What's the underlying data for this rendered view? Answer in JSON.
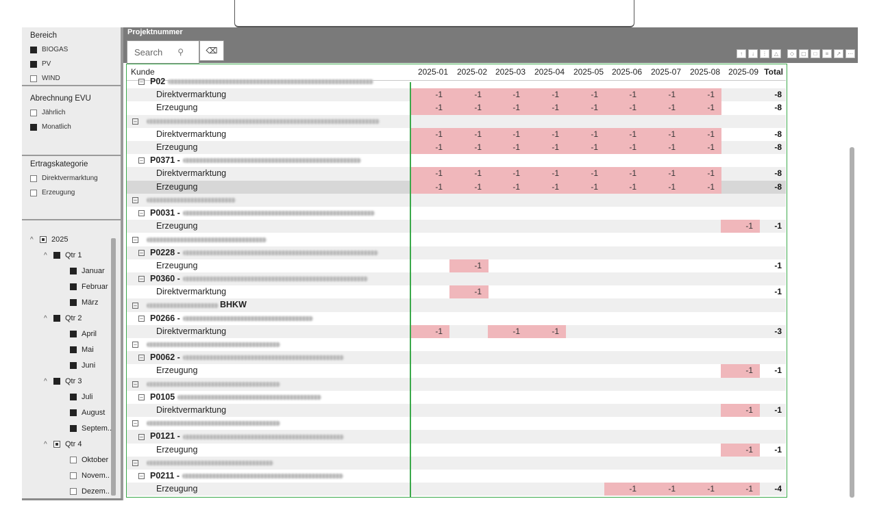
{
  "slicers": {
    "bereich": {
      "title": "Bereich",
      "options": [
        {
          "label": "BIOGAS",
          "checked": true
        },
        {
          "label": "PV",
          "checked": true
        },
        {
          "label": "WIND",
          "checked": false
        }
      ]
    },
    "abrechnung": {
      "title": "Abrechnung EVU",
      "options": [
        {
          "label": "Jährlich",
          "checked": false
        },
        {
          "label": "Monatlich",
          "checked": true
        }
      ]
    },
    "ertragskategorie": {
      "title": "Ertragskategorie",
      "options": [
        {
          "label": "Direktvermarktung",
          "checked": false
        },
        {
          "label": "Erzeugung",
          "checked": false
        }
      ]
    }
  },
  "date_tree": {
    "year": "2025",
    "quarters": [
      {
        "label": "Qtr 1",
        "state": "on",
        "months": [
          {
            "label": "Januar",
            "checked": true
          },
          {
            "label": "Februar",
            "checked": true
          },
          {
            "label": "März",
            "checked": true
          }
        ]
      },
      {
        "label": "Qtr 2",
        "state": "on",
        "months": [
          {
            "label": "April",
            "checked": true
          },
          {
            "label": "Mai",
            "checked": true
          },
          {
            "label": "Juni",
            "checked": true
          }
        ]
      },
      {
        "label": "Qtr 3",
        "state": "on",
        "months": [
          {
            "label": "Juli",
            "checked": true
          },
          {
            "label": "August",
            "checked": true
          },
          {
            "label": "Septem..",
            "checked": true
          }
        ]
      },
      {
        "label": "Qtr 4",
        "state": "partial",
        "months": [
          {
            "label": "Oktober",
            "checked": false
          },
          {
            "label": "Novem..",
            "checked": false
          },
          {
            "label": "Dezem..",
            "checked": false
          }
        ]
      }
    ]
  },
  "projekt": {
    "label": "Projektnummer",
    "search_placeholder": "Search",
    "search_icon": "search-icon",
    "eraser_icon": "eraser-icon"
  },
  "visual_icons": [
    "sort-asc-icon",
    "sort-desc-icon",
    "drill-icon",
    "expand-icon",
    "pin-icon",
    "copy-icon",
    "comment-icon",
    "filter-icon",
    "focus-icon",
    "more-icon"
  ],
  "matrix": {
    "header": {
      "kunde": "Kunde",
      "months": [
        "2025-01",
        "2025-02",
        "2025-03",
        "2025-04",
        "2025-05",
        "2025-06",
        "2025-07",
        "2025-08",
        "2025-09"
      ],
      "total": "Total"
    },
    "rows": [
      {
        "level": 1,
        "label": "P02",
        "blur": 300,
        "bold": true,
        "values": [],
        "total": ""
      },
      {
        "level": 2,
        "label": "Direktvermarktung",
        "values": [
          -1,
          -1,
          -1,
          -1,
          -1,
          -1,
          -1,
          -1,
          null
        ],
        "total": "-8"
      },
      {
        "level": 2,
        "label": "Erzeugung",
        "values": [
          -1,
          -1,
          -1,
          -1,
          -1,
          -1,
          -1,
          -1,
          null
        ],
        "total": "-8"
      },
      {
        "level": 0,
        "label": "",
        "blur": 340,
        "values": [],
        "total": ""
      },
      {
        "level": 2,
        "label": "Direktvermarktung",
        "values": [
          -1,
          -1,
          -1,
          -1,
          -1,
          -1,
          -1,
          -1,
          null
        ],
        "total": "-8"
      },
      {
        "level": 2,
        "label": "Erzeugung",
        "values": [
          -1,
          -1,
          -1,
          -1,
          -1,
          -1,
          -1,
          -1,
          null
        ],
        "total": "-8"
      },
      {
        "level": 1,
        "label": "P0371 -",
        "blur": 260,
        "bold": true,
        "values": [],
        "total": ""
      },
      {
        "level": 2,
        "label": "Direktvermarktung",
        "values": [
          -1,
          -1,
          -1,
          -1,
          -1,
          -1,
          -1,
          -1,
          null
        ],
        "total": "-8"
      },
      {
        "level": 2,
        "label": "Erzeugung",
        "values": [
          -1,
          -1,
          -1,
          -1,
          -1,
          -1,
          -1,
          -1,
          null
        ],
        "total": "-8",
        "selected": true
      },
      {
        "level": 0,
        "label": "",
        "blur": 130,
        "values": [],
        "total": ""
      },
      {
        "level": 1,
        "label": "P0031 -",
        "blur": 280,
        "bold": true,
        "values": [],
        "total": ""
      },
      {
        "level": 2,
        "label": "Erzeugung",
        "values": [
          null,
          null,
          null,
          null,
          null,
          null,
          null,
          null,
          -1
        ],
        "total": "-1"
      },
      {
        "level": 0,
        "label": "",
        "blur": 175,
        "values": [],
        "total": ""
      },
      {
        "level": 1,
        "label": "P0228 -",
        "blur": 285,
        "bold": true,
        "values": [],
        "total": ""
      },
      {
        "level": 2,
        "label": "Erzeugung",
        "values": [
          null,
          -1,
          null,
          null,
          null,
          null,
          null,
          null,
          null
        ],
        "total": "-1"
      },
      {
        "level": 1,
        "label": "P0360 -",
        "blur": 270,
        "bold": true,
        "values": [],
        "total": ""
      },
      {
        "level": 2,
        "label": "Direktvermarktung",
        "values": [
          null,
          -1,
          null,
          null,
          null,
          null,
          null,
          null,
          null
        ],
        "total": "-1"
      },
      {
        "level": 0,
        "label": "BHKW",
        "blur": 105,
        "bold": true,
        "values": [],
        "total": ""
      },
      {
        "level": 1,
        "label": "P0266 -",
        "blur": 190,
        "bold": true,
        "values": [],
        "total": ""
      },
      {
        "level": 2,
        "label": "Direktvermarktung",
        "values": [
          -1,
          null,
          -1,
          -1,
          null,
          null,
          null,
          null,
          null
        ],
        "total": "-3"
      },
      {
        "level": 0,
        "label": "",
        "blur": 195,
        "values": [],
        "total": ""
      },
      {
        "level": 1,
        "label": "P0062 -",
        "blur": 235,
        "bold": true,
        "values": [],
        "total": ""
      },
      {
        "level": 2,
        "label": "Erzeugung",
        "values": [
          null,
          null,
          null,
          null,
          null,
          null,
          null,
          null,
          -1
        ],
        "total": "-1"
      },
      {
        "level": 0,
        "label": "",
        "blur": 195,
        "values": [],
        "total": ""
      },
      {
        "level": 1,
        "label": "P0105",
        "blur": 210,
        "bold": true,
        "values": [],
        "total": ""
      },
      {
        "level": 2,
        "label": "Direktvermarktung",
        "values": [
          null,
          null,
          null,
          null,
          null,
          null,
          null,
          null,
          -1
        ],
        "total": "-1"
      },
      {
        "level": 0,
        "label": "",
        "blur": 195,
        "values": [],
        "total": ""
      },
      {
        "level": 1,
        "label": "P0121 -",
        "blur": 235,
        "bold": true,
        "values": [],
        "total": ""
      },
      {
        "level": 2,
        "label": "Erzeugung",
        "values": [
          null,
          null,
          null,
          null,
          null,
          null,
          null,
          null,
          -1
        ],
        "total": "-1"
      },
      {
        "level": 0,
        "label": "",
        "blur": 185,
        "values": [],
        "total": ""
      },
      {
        "level": 1,
        "label": "P0211 -",
        "blur": 235,
        "bold": true,
        "values": [],
        "total": ""
      },
      {
        "level": 2,
        "label": "Erzeugung",
        "values": [
          null,
          null,
          null,
          null,
          null,
          -1,
          -1,
          -1,
          -1
        ],
        "total": "-4"
      }
    ]
  }
}
